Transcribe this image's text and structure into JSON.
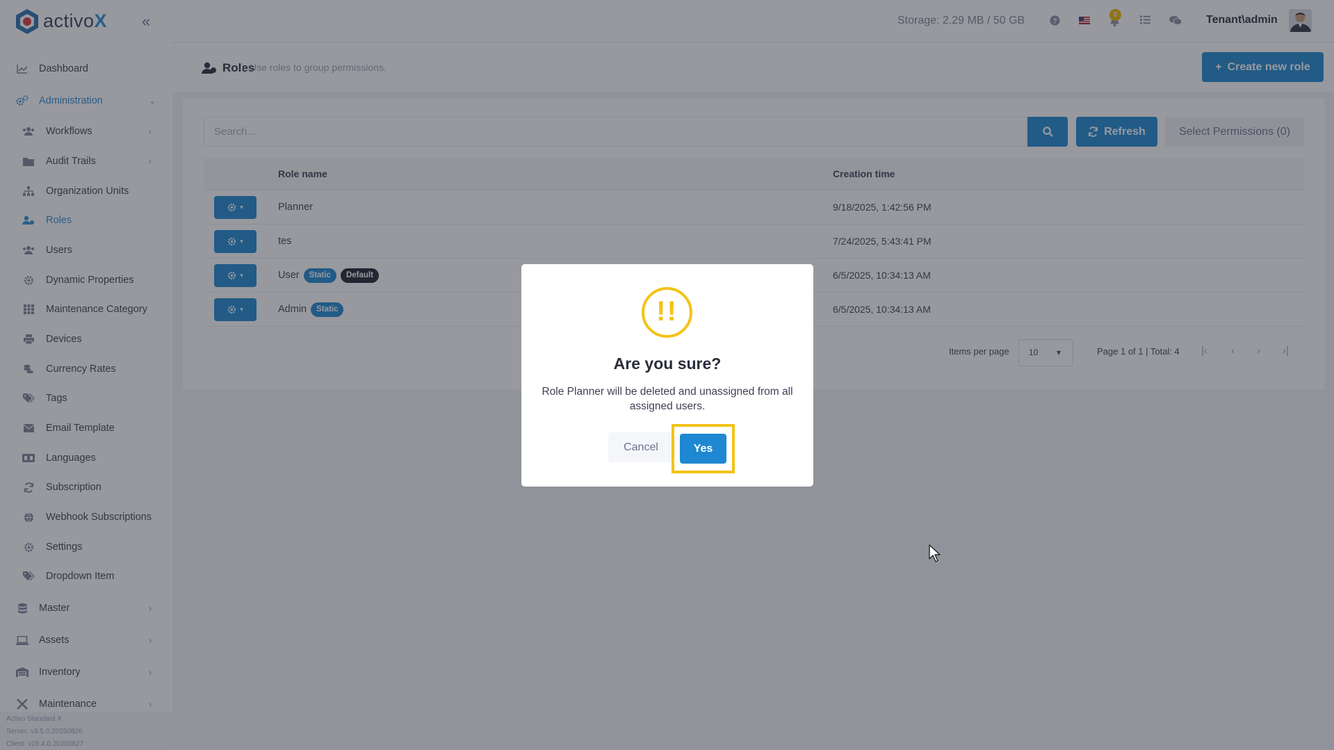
{
  "app": {
    "logo_main": "activo",
    "logo_accent": "X"
  },
  "header": {
    "storage": "Storage: 2.29 MB / 50 GB",
    "notifications_count": "8",
    "tenant_user": "Tenant\\admin"
  },
  "sidebar": {
    "items": [
      {
        "label": "Dashboard",
        "icon": "chart-line-icon"
      },
      {
        "label": "Administration",
        "icon": "cogs-icon"
      },
      {
        "label": "Workflows",
        "icon": "users-icon"
      },
      {
        "label": "Audit Trails",
        "icon": "folder-icon"
      },
      {
        "label": "Organization Units",
        "icon": "sitemap-icon"
      },
      {
        "label": "Roles",
        "icon": "user-role-icon"
      },
      {
        "label": "Users",
        "icon": "users-icon"
      },
      {
        "label": "Dynamic Properties",
        "icon": "gear-icon"
      },
      {
        "label": "Maintenance Category",
        "icon": "grid-icon"
      },
      {
        "label": "Devices",
        "icon": "printer-icon"
      },
      {
        "label": "Currency Rates",
        "icon": "coins-icon"
      },
      {
        "label": "Tags",
        "icon": "tags-icon"
      },
      {
        "label": "Email Template",
        "icon": "envelope-icon"
      },
      {
        "label": "Languages",
        "icon": "language-icon"
      },
      {
        "label": "Subscription",
        "icon": "sync-icon"
      },
      {
        "label": "Webhook Subscriptions",
        "icon": "globe-icon"
      },
      {
        "label": "Settings",
        "icon": "gear-icon"
      },
      {
        "label": "Dropdown Item",
        "icon": "tags-icon"
      },
      {
        "label": "Master",
        "icon": "database-icon"
      },
      {
        "label": "Assets",
        "icon": "laptop-icon"
      },
      {
        "label": "Inventory",
        "icon": "warehouse-icon"
      },
      {
        "label": "Maintenance",
        "icon": "tools-icon"
      }
    ],
    "footer": {
      "product": "Activo Standard X",
      "server": "Server: v3.5.0.20250826",
      "client": "Client: v19.4.0.20250827"
    }
  },
  "page": {
    "title": "Roles",
    "description": "Use roles to group permissions.",
    "create_button": "Create new role"
  },
  "toolbar": {
    "search_placeholder": "Search...",
    "refresh_label": "Refresh",
    "select_permissions_label": "Select Permissions (0)"
  },
  "table": {
    "columns": [
      "Role name",
      "Creation time"
    ],
    "rows": [
      {
        "name": "Planner",
        "badges": [],
        "created": "9/18/2025, 1:42:56 PM"
      },
      {
        "name": "tes",
        "badges": [],
        "created": "7/24/2025, 5:43:41 PM"
      },
      {
        "name": "User",
        "badges": [
          "Static",
          "Default"
        ],
        "created": "6/5/2025, 10:34:13 AM"
      },
      {
        "name": "Admin",
        "badges": [
          "Static"
        ],
        "created": "6/5/2025, 10:34:13 AM"
      }
    ]
  },
  "pagination": {
    "items_per_page_label": "Items per page",
    "items_per_page_value": "10",
    "summary": "Page 1 of 1 | Total: 4"
  },
  "modal": {
    "icon": "!!",
    "title": "Are you sure?",
    "message": "Role Planner will be deleted and unassigned from all assigned users.",
    "cancel_label": "Cancel",
    "confirm_label": "Yes"
  },
  "colors": {
    "primary": "#1e88d2",
    "warning": "#f3c317",
    "dark_badge": "#1f2130"
  }
}
